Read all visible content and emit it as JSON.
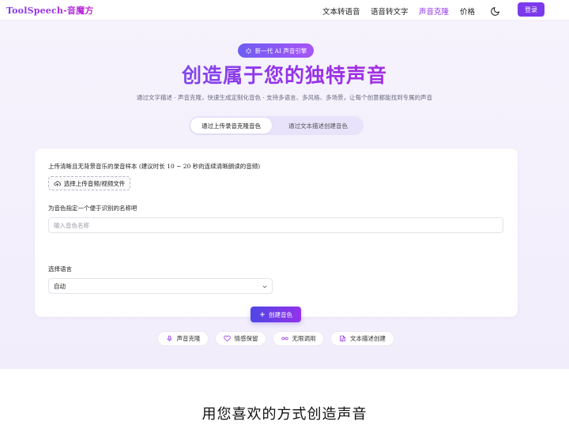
{
  "nav": {
    "brand": "ToolSpeech-音魔方",
    "links": [
      "文本转语音",
      "语音转文字",
      "声音克隆",
      "价格"
    ],
    "active_link": "声音克隆",
    "theme_icon": "moon-icon",
    "login_label": "登录"
  },
  "hero": {
    "badge": "新一代 AI 声音引擎",
    "title": "创造属于您的独特声音",
    "subtitle": "通过文字描述 · 声音克隆，快速生成定制化音色 · 支持多语言、多风格、多场景，让每个创意都能找到专属的声音"
  },
  "mode_tabs": {
    "active": "通过上传录音克隆音色",
    "inactive": "通过文本描述创建音色"
  },
  "form": {
    "upload_label": "上传清晰且无背景音乐的录音样本 (建议时长 10 ~ 20 秒的连续清晰朗读的音频)",
    "upload_button": "选择上传音频/视频文件",
    "name_label": "为音色指定一个便于识别的名称吧",
    "name_placeholder": "输入音色名称",
    "language_label": "选择语言",
    "language_value": "自动",
    "create_button": "创建音色"
  },
  "features": [
    {
      "icon": "microphone-icon",
      "label": "声音克隆"
    },
    {
      "icon": "heart-icon",
      "label": "情感保留"
    },
    {
      "icon": "infinity-icon",
      "label": "无限调用"
    },
    {
      "icon": "document-icon",
      "label": "文本描述创建"
    }
  ],
  "section": {
    "title": "用您喜欢的方式创造声音"
  },
  "colors": {
    "accent": "#7c3aed",
    "accent_magenta": "#c026d3",
    "hero_bg": "#f5f1fd"
  }
}
